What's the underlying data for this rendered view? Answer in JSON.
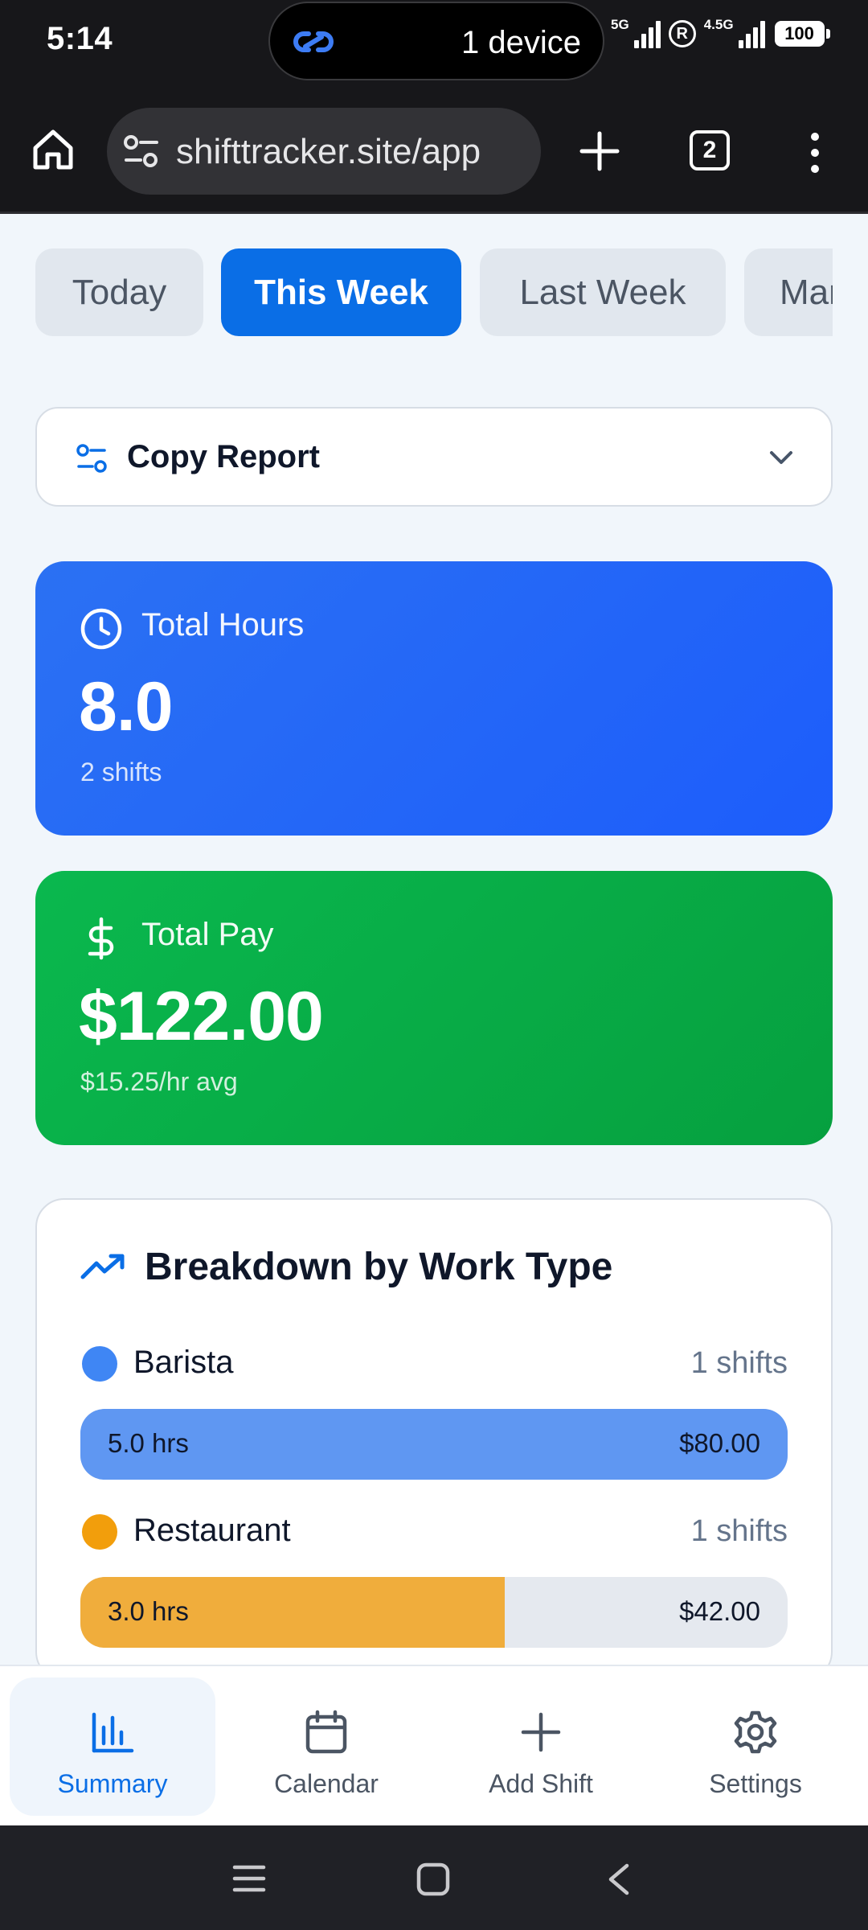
{
  "status_bar": {
    "time": "5:14",
    "device_pill": "1 device",
    "net1": "5G",
    "net2": "4.5G",
    "r_badge": "R",
    "battery": "100"
  },
  "browser": {
    "url": "shifttracker.site/app",
    "tab_count": "2"
  },
  "period_tabs": [
    {
      "label": "Today",
      "active": false
    },
    {
      "label": "This Week",
      "active": true
    },
    {
      "label": "Last Week",
      "active": false
    },
    {
      "label": "Mar",
      "active": false
    }
  ],
  "copy_report": {
    "label": "Copy Report"
  },
  "total_hours": {
    "label": "Total Hours",
    "value": "8.0",
    "sub": "2 shifts",
    "color": "#2266f6"
  },
  "total_pay": {
    "label": "Total Pay",
    "value": "$122.00",
    "sub": "$15.25/hr avg",
    "color": "#07ab46"
  },
  "breakdown": {
    "title": "Breakdown by Work Type",
    "items": [
      {
        "name": "Barista",
        "count": "1 shifts",
        "hours": "5.0 hrs",
        "pay": "$80.00",
        "color": "#3f86f4",
        "bar_color": "#5f97f2",
        "fill_fraction": 1.0
      },
      {
        "name": "Restaurant",
        "count": "1 shifts",
        "hours": "3.0 hrs",
        "pay": "$42.00",
        "color": "#f29e0c",
        "bar_color": "#f0ad3c",
        "fill_fraction": 0.6
      }
    ]
  },
  "bottom_nav": [
    {
      "label": "Summary",
      "icon": "bar-chart-icon",
      "active": true
    },
    {
      "label": "Calendar",
      "icon": "calendar-icon",
      "active": false
    },
    {
      "label": "Add Shift",
      "icon": "plus-icon",
      "active": false
    },
    {
      "label": "Settings",
      "icon": "gear-icon",
      "active": false
    }
  ],
  "colors": {
    "accent": "#0a6ee6"
  }
}
